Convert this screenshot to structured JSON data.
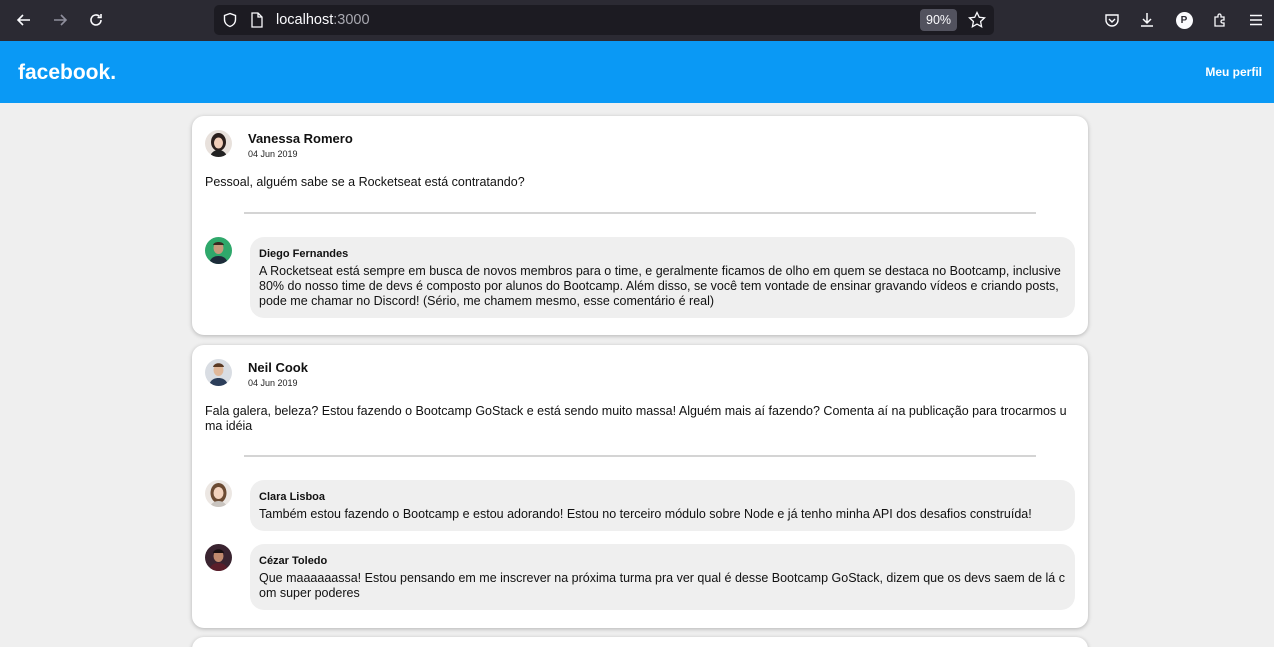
{
  "browser": {
    "url_host": "localhost",
    "url_port": ":3000",
    "zoom": "90%",
    "profile_initial": "P"
  },
  "header": {
    "logo": "facebook.",
    "profile_link": "Meu perfil"
  },
  "posts": [
    {
      "author": "Vanessa Romero",
      "date": "04 Jun 2019",
      "content": "Pessoal, alguém sabe se a Rocketseat está contratando?",
      "comments": [
        {
          "author": "Diego Fernandes",
          "content": "A Rocketseat está sempre em busca de novos membros para o time, e geralmente ficamos de olho em quem se destaca no Bootcamp, inclusive 80% do nosso time de devs é composto por alunos do Bootcamp. Além disso, se você tem vontade de ensinar gravando vídeos e criando posts, pode me chamar no Discord! (Sério, me chamem mesmo, esse comentário é real)"
        }
      ]
    },
    {
      "author": "Neil Cook",
      "date": "04 Jun 2019",
      "content": "Fala galera, beleza? Estou fazendo o Bootcamp GoStack e está sendo muito massa! Alguém mais aí fazendo? Comenta aí na publicação para trocarmos uma idéia",
      "comments": [
        {
          "author": "Clara Lisboa",
          "content": "Também estou fazendo o Bootcamp e estou adorando! Estou no terceiro módulo sobre Node e já tenho minha API dos desafios construída!"
        },
        {
          "author": "Cézar Toledo",
          "content": "Que maaaaaassa! Estou pensando em me inscrever na próxima turma pra ver qual é desse Bootcamp GoStack, dizem que os devs saem de lá com super poderes"
        }
      ]
    }
  ]
}
